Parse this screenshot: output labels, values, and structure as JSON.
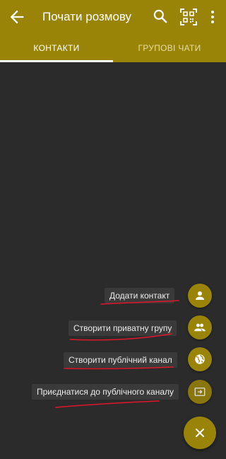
{
  "header": {
    "title": "Почати розмову",
    "back_icon": "arrow-back-icon",
    "search_icon": "search-icon",
    "qr_icon": "qr-scan-icon",
    "more_icon": "more-vert-icon"
  },
  "tabs": [
    {
      "label": "КОНТАКТИ",
      "active": true
    },
    {
      "label": "ГРУПОВІ ЧАТИ",
      "active": false
    }
  ],
  "fab_menu": {
    "items": [
      {
        "label": "Додати контакт",
        "icon": "person-icon"
      },
      {
        "label": "Створити приватну групу",
        "icon": "group-icon"
      },
      {
        "label": "Створити публічний канал",
        "icon": "globe-icon"
      },
      {
        "label": "Приєднатися до публічного каналу",
        "icon": "join-channel-icon"
      }
    ],
    "close_icon": "close-icon"
  },
  "colors": {
    "accent": "#9a8407",
    "background": "#2b2b2b",
    "label_background": "#3a3a3a",
    "annotation_underline": "#e0162b"
  }
}
